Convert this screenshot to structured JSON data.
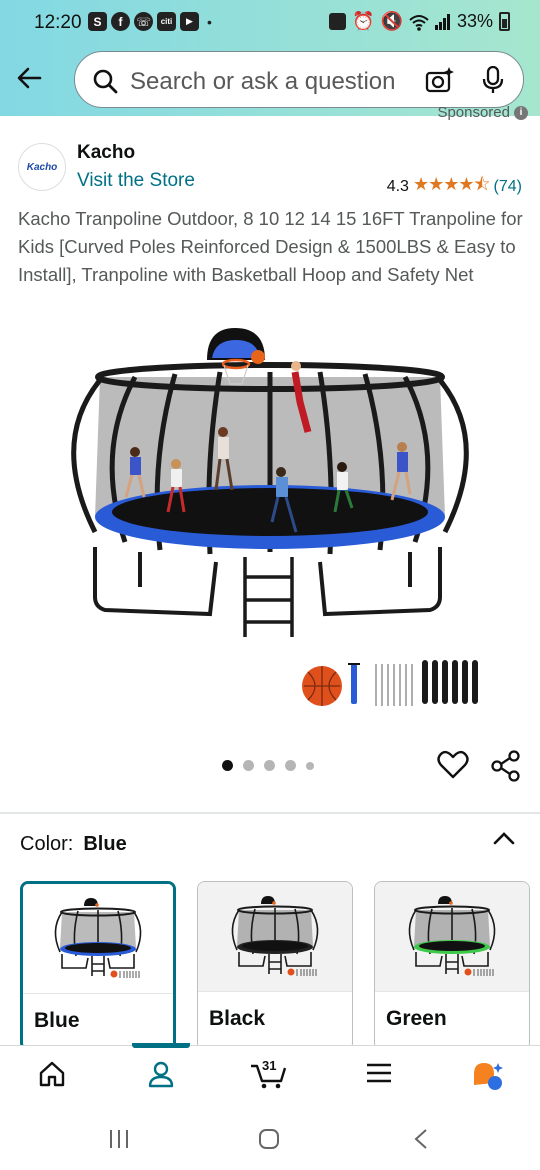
{
  "status_bar": {
    "time": "12:20",
    "notification_icons": [
      "S",
      "f",
      "☏",
      "citi",
      "▶"
    ],
    "battery": "33%"
  },
  "search": {
    "placeholder": "Search or ask a question"
  },
  "sponsored_label": "Sponsored",
  "brand": {
    "logo_text": "Kacho",
    "name": "Kacho",
    "store_link": "Visit the Store"
  },
  "rating": {
    "value": "4.3",
    "stars": "★★★★⯪",
    "count": "(74)"
  },
  "product": {
    "title": "Kacho Tranpoline Outdoor, 8 10 12 14 15 16FT Tranpoline for Kids [Curved Poles Reinforced Design & 1500LBS & Easy to Install], Tranpoline with Basketball Hoop and Safety Net"
  },
  "carousel": {
    "image_count": 5,
    "active_index": 0
  },
  "color_selector": {
    "label": "Color:",
    "selected": "Blue",
    "options": [
      {
        "label": "Blue",
        "mat_color": "#2a5bd7"
      },
      {
        "label": "Black",
        "mat_color": "#222222"
      },
      {
        "label": "Green",
        "mat_color": "#3fc94a"
      }
    ]
  },
  "bottom_nav": {
    "items": [
      "home",
      "account",
      "cart",
      "menu",
      "rufus"
    ],
    "active": "account",
    "cart_count": "31"
  },
  "colors": {
    "accent_teal": "#007185",
    "star_orange": "#de7921",
    "header_gradient_start": "#82d8e3",
    "header_gradient_end": "#a6e6ce"
  }
}
